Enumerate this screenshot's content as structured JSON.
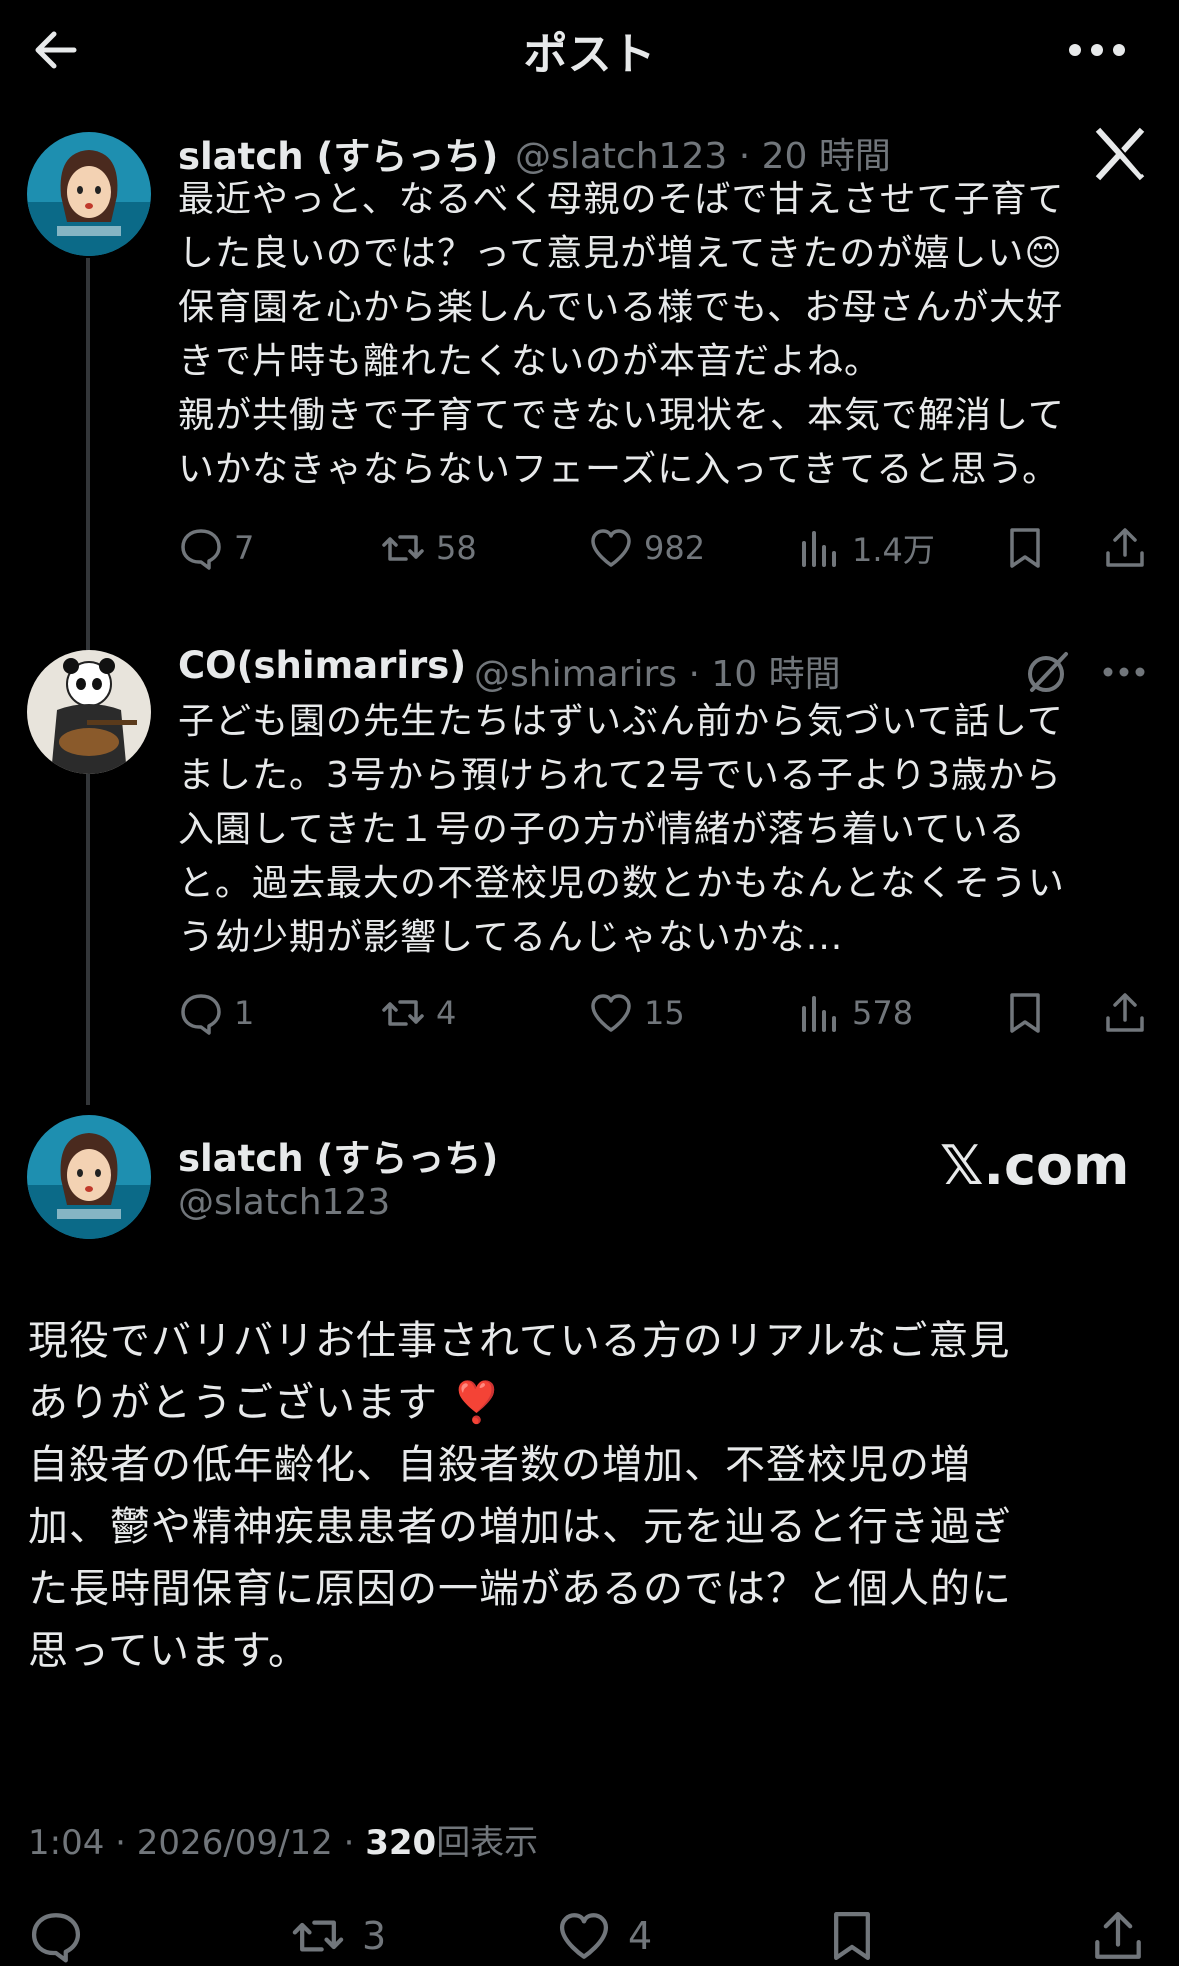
{
  "header": {
    "title": "ポスト"
  },
  "thread_tweet": {
    "name": "slatch (すらっち)",
    "handle": "@slatch123",
    "time": "20 時間",
    "text": "最近やっと、なるべく母親のそばで甘えさせて子育て\nした良いのでは？って意見が増えてきたのが嬉しい😊\n保育園を心から楽しんでいる様でも、お母さんが大好\nきで片時も離れたくないのが本音だよね。\n親が共働きで子育てできない現状を、本気で解消して\nいかなきゃならないフェーズに入ってきてると思う。",
    "replies": "7",
    "retweets": "58",
    "likes": "982",
    "views": "1.4万"
  },
  "reply_tweet": {
    "name": "CO(shimarirs)",
    "handle": "@shimarirs",
    "time": "10 時間",
    "text": "子ども園の先生たちはずいぶん前から気づいて話して\nました。3号から預けられて2号でいる子より3歳から\n入園してきた１号の子の方が情緒が落ち着いている\nと。過去最大の不登校児の数とかもなんとなくそうい\nう幼少期が影響してるんじゃないかな...",
    "replies": "1",
    "retweets": "4",
    "likes": "15",
    "views": "578"
  },
  "main_tweet": {
    "name": "slatch (すらっち)",
    "handle": "@slatch123",
    "brand": "𝕏.com",
    "text": "現役でバリバリお仕事されている方のリアルなご意見\nありがとうございます ❣️\n自殺者の低年齢化、自殺者数の増加、不登校児の増\n加、鬱や精神疾患患者の増加は、元を辿ると行き過ぎ\nた長時間保育に原因の一端があるのでは？と個人的に\n思っています。",
    "time": "1:04",
    "date": "2026/09/12",
    "views_count": "320",
    "views_label": "回表示",
    "retweets": "3",
    "likes": "4"
  },
  "colors": {
    "background": "#000000",
    "text": "#e7e9ea",
    "muted": "#71767b",
    "line": "#333639"
  }
}
